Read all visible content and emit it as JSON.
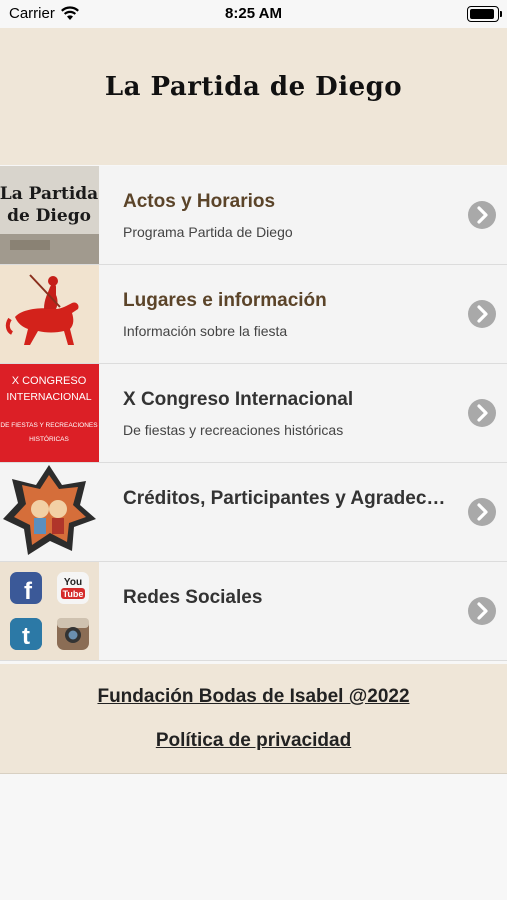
{
  "status_bar": {
    "carrier": "Carrier",
    "time": "8:25 AM"
  },
  "header": {
    "title": "La Partida de Diego"
  },
  "menu": {
    "items": [
      {
        "title": "Actos y Horarios",
        "subtitle": "Programa Partida de Diego",
        "thumb_text": [
          "La Partida",
          "de Diego"
        ]
      },
      {
        "title": "Lugares e información",
        "subtitle": "Información sobre la fiesta"
      },
      {
        "title": "X Congreso Internacional",
        "subtitle": "De fiestas y recreaciones históricas",
        "thumb_text": [
          "X CONGRESO",
          "INTERNACIONAL",
          "DE FIESTAS Y RECREACIONES",
          "HISTÓRICAS"
        ]
      },
      {
        "title": "Créditos, Participantes y Agradec…",
        "subtitle": ""
      },
      {
        "title": "Redes Sociales",
        "subtitle": "",
        "thumb_text": [
          "You",
          "Tube"
        ]
      }
    ]
  },
  "footer": {
    "link_1": "Fundación Bodas de Isabel @2022",
    "link_2": "Política de privacidad"
  },
  "colors": {
    "header_bg": "#efe6d8",
    "title_brown": "#5b4429",
    "chevron_gray": "#a9a9a9",
    "congress_red": "#dc1f26"
  },
  "icons": [
    "wifi-icon",
    "battery-icon",
    "chevron-right-icon",
    "horseman-icon",
    "facebook-icon",
    "youtube-icon",
    "tumblr-icon",
    "instagram-icon"
  ]
}
